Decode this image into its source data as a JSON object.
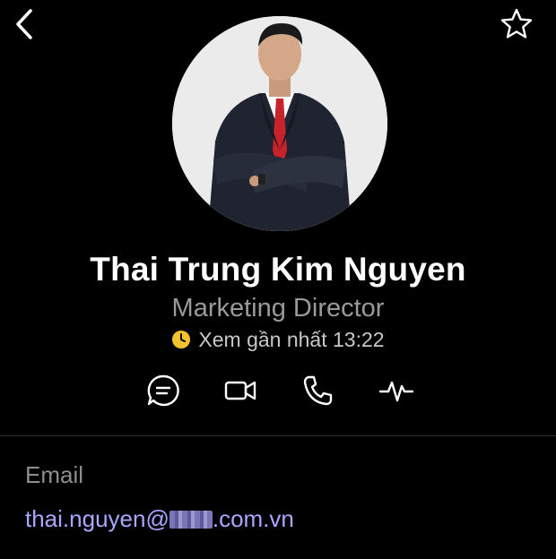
{
  "nav": {
    "back_icon": "chevron-left-icon",
    "favorite_icon": "star-outline-icon"
  },
  "profile": {
    "name": "Thai Trung Kim Nguyen",
    "title": "Marketing Director",
    "last_seen": "Xem gần nhất 13:22",
    "avatar_description_icon": "profile-photo"
  },
  "actions": [
    {
      "icon": "chat-icon"
    },
    {
      "icon": "video-call-icon"
    },
    {
      "icon": "phone-icon"
    },
    {
      "icon": "activity-icon"
    }
  ],
  "contact": {
    "email_label": "Email",
    "email_prefix": "thai.nguyen@",
    "email_suffix": ".com.vn"
  },
  "colors": {
    "background": "#000000",
    "name": "#ffffff",
    "title": "#9a9a9a",
    "link": "#a9a7ff",
    "clock": "#f2c32e"
  }
}
